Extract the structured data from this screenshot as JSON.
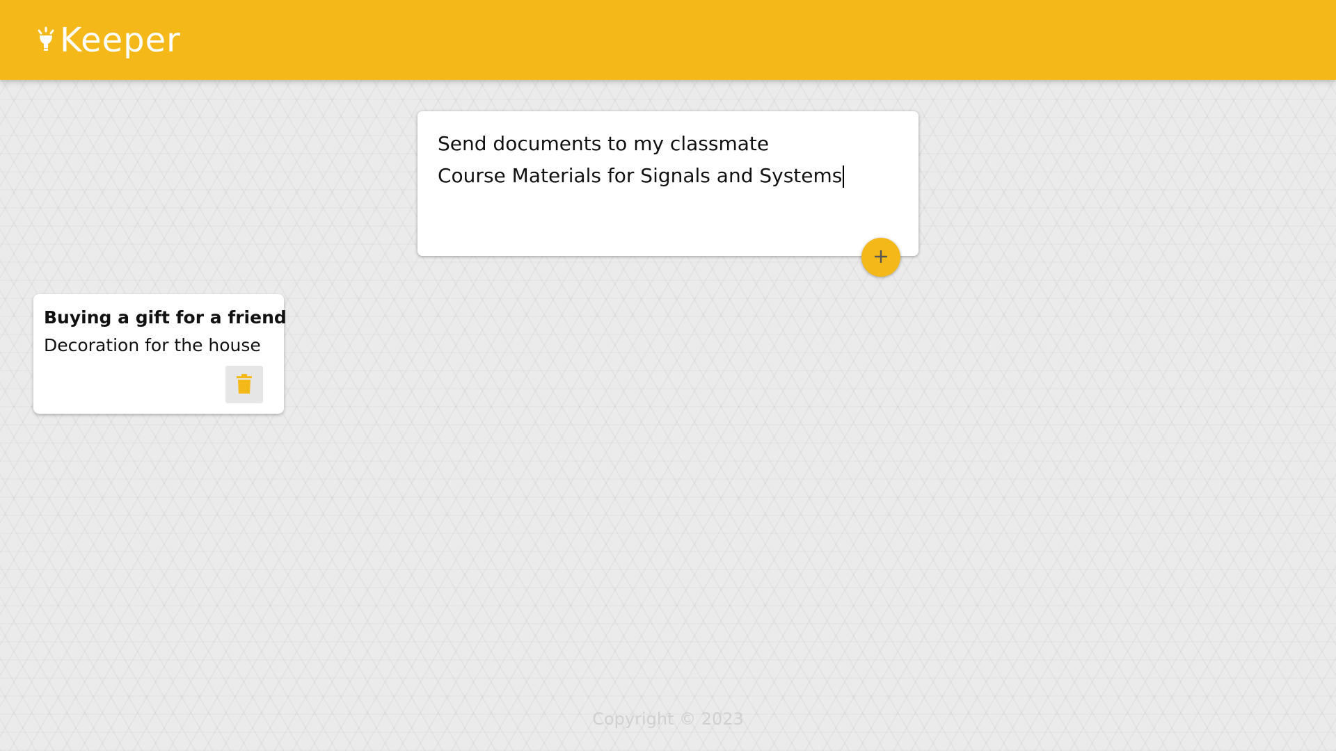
{
  "header": {
    "app_name": "Keeper",
    "logo_icon": "lightbulb-icon",
    "background_color": "#f4b918"
  },
  "create_note": {
    "title_value": "Send documents to my classmate",
    "content_value": "Course Materials for Signals and Systems",
    "add_icon": "plus-icon"
  },
  "notes": [
    {
      "title": "Buying a gift for a friend",
      "content": "Decoration for the house",
      "delete_icon": "trash-icon"
    }
  ],
  "footer": {
    "copyright": "Copyright © 2023"
  },
  "colors": {
    "accent": "#f4b918",
    "page_background": "#ebebeb"
  }
}
